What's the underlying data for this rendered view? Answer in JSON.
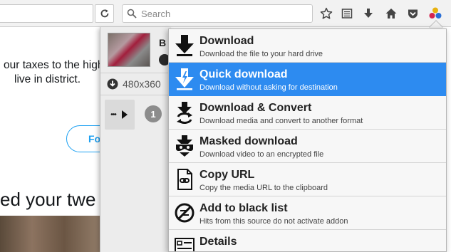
{
  "toolbar": {
    "search_placeholder": "Search",
    "icons": [
      "reload-icon",
      "search-icon",
      "bookmark-star-icon",
      "reading-list-icon",
      "downloads-icon",
      "home-icon",
      "pocket-icon",
      "video-downloadhelper-icon"
    ]
  },
  "page": {
    "line1": "our taxes to the highes",
    "line2": "live in district.",
    "follow_label": "Fo",
    "heading": "ed your twe"
  },
  "panel": {
    "video_title": "B",
    "resolution": "480x360",
    "actions_label": "•••",
    "count": "1"
  },
  "menu": {
    "selected_color": "#2d8bf0",
    "items": [
      {
        "title": "Download",
        "desc": "Download the file to your hard drive",
        "icon": "download-arrow-icon"
      },
      {
        "title": "Quick download",
        "desc": "Download without asking for destination",
        "icon": "quick-download-icon"
      },
      {
        "title": "Download & Convert",
        "desc": "Download media and convert to another format",
        "icon": "download-convert-icon"
      },
      {
        "title": "Masked download",
        "desc": "Download video to an encrypted file",
        "icon": "masked-download-icon"
      },
      {
        "title": "Copy URL",
        "desc": "Copy the media URL to the clipboard",
        "icon": "copy-url-icon"
      },
      {
        "title": "Add to black list",
        "desc": "Hits from this source do not activate addon",
        "icon": "blacklist-icon"
      },
      {
        "title": "Details",
        "desc": "",
        "icon": "details-icon"
      }
    ]
  }
}
